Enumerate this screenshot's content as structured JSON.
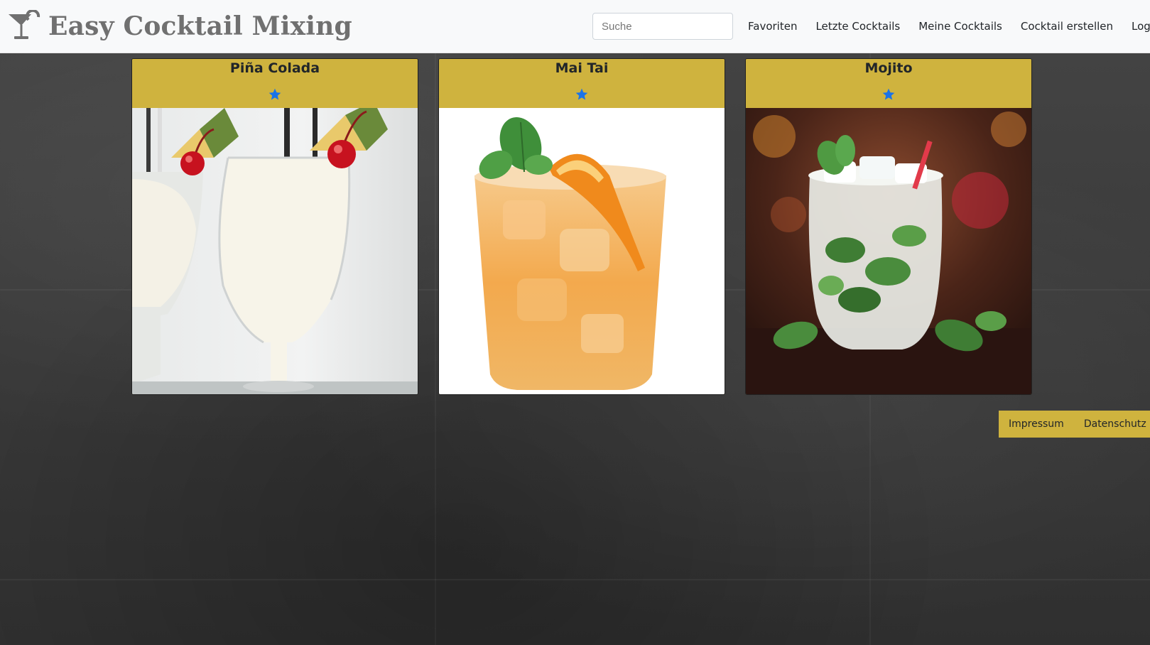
{
  "header": {
    "brand_name": "Easy Cocktail Mixing",
    "logo_icon": "cocktail-glass-icon",
    "search_placeholder": "Suche",
    "nav": [
      {
        "label": "Favoriten"
      },
      {
        "label": "Letzte Cocktails"
      },
      {
        "label": "Meine Cocktails"
      },
      {
        "label": "Cocktail erstellen"
      },
      {
        "label": "Logout"
      }
    ]
  },
  "cards": [
    {
      "title": "Piña Colada",
      "favorite_icon": "star-icon",
      "image": "pina-colada-photo"
    },
    {
      "title": "Mai Tai",
      "favorite_icon": "star-icon",
      "image": "mai-tai-photo"
    },
    {
      "title": "Mojito",
      "favorite_icon": "star-icon",
      "image": "mojito-photo"
    }
  ],
  "footer": {
    "links": [
      {
        "label": "Impressum"
      },
      {
        "label": "Datenschutz"
      }
    ]
  },
  "colors": {
    "accent": "#cfb33e",
    "navbar_bg": "#f8f9fa",
    "brand_text": "#707070",
    "star": "#1a73e8"
  }
}
